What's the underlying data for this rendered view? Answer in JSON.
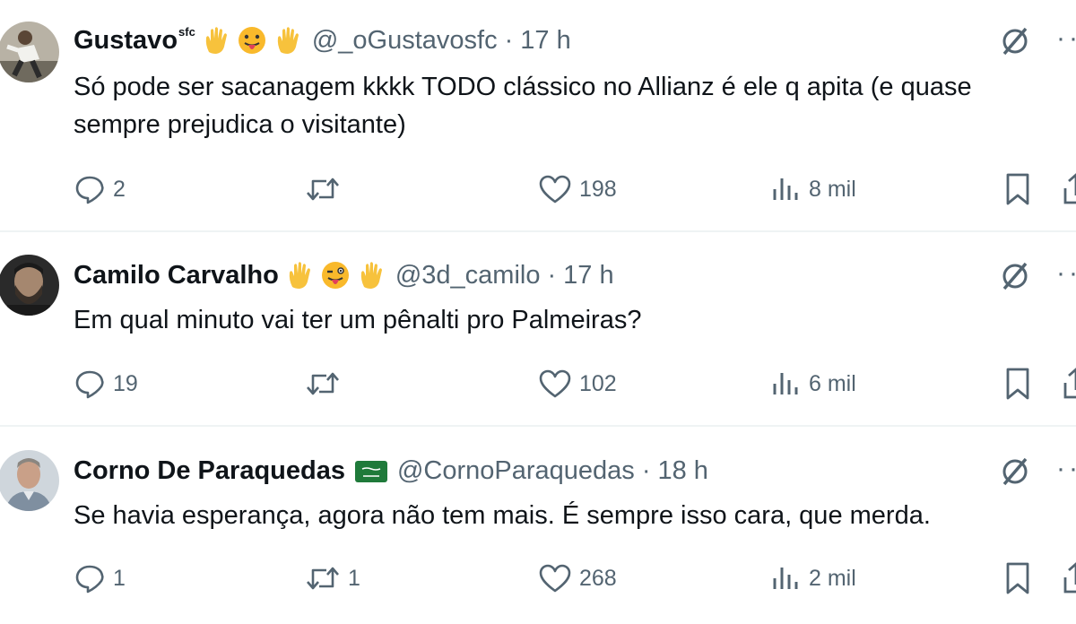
{
  "tweets": [
    {
      "name": "Gustavo",
      "name_superscript": "sfc",
      "handle": "@_oGustavosfc",
      "separator": "·",
      "time": "17 h",
      "text": "Só pode ser sacanagem kkkk TODO clássico no Allianz é ele q apita (e quase sempre prejudica o visitante)",
      "replies": "2",
      "retweets": "",
      "likes": "198",
      "views": "8 mil",
      "more": "··"
    },
    {
      "name": "Camilo Carvalho",
      "handle": "@3d_camilo",
      "separator": "·",
      "time": "17 h",
      "text": "Em qual minuto vai ter um pênalti pro Palmeiras?",
      "replies": "19",
      "retweets": "",
      "likes": "102",
      "views": "6 mil",
      "more": "··"
    },
    {
      "name": "Corno De Paraquedas",
      "handle": "@CornoParaquedas",
      "separator": "·",
      "time": "18 h",
      "text": "Se havia esperança, agora não tem mais. É sempre isso cara, que merda.",
      "replies": "1",
      "retweets": "1",
      "likes": "268",
      "views": "2 mil",
      "more": "··"
    }
  ],
  "colors": {
    "text_primary": "#0f1419",
    "text_secondary": "#536471",
    "divider": "#eff3f4",
    "emoji_hand": "#f7c23c",
    "emoji_face": "#f9b92b"
  },
  "icons": {
    "reply": "speech-bubble-icon",
    "retweet": "retweet-arrows-icon",
    "like": "heart-icon",
    "views": "bar-chart-icon",
    "bookmark": "bookmark-icon",
    "share": "share-icon",
    "grok": "grok-slash-icon",
    "flag": "saudi-flag-icon"
  }
}
